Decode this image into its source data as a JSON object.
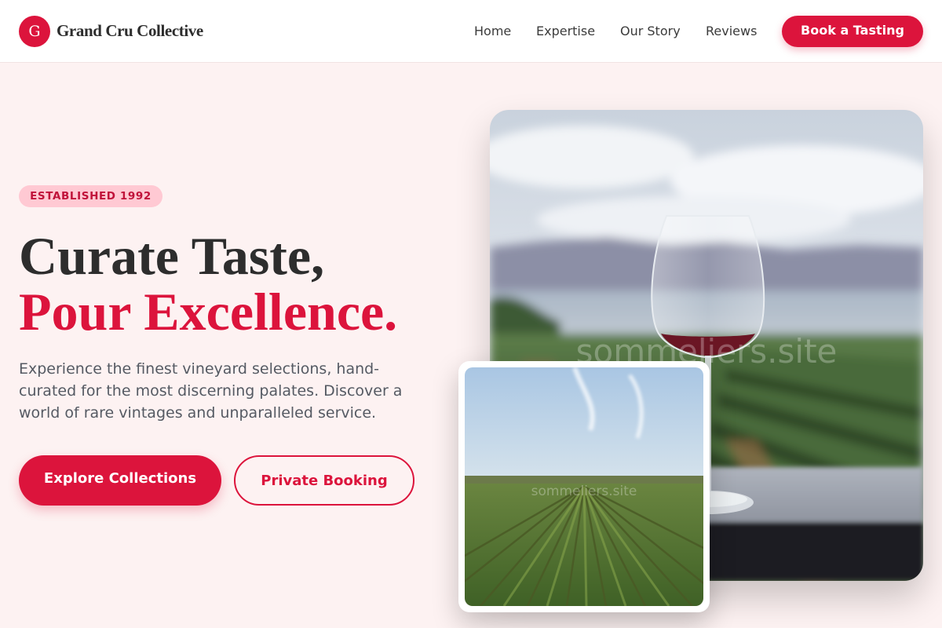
{
  "brand": {
    "initial": "G",
    "name": "Grand Cru Collective"
  },
  "nav": {
    "links": [
      "Home",
      "Expertise",
      "Our Story",
      "Reviews"
    ],
    "cta": "Book a Tasting"
  },
  "hero": {
    "badge": "ESTABLISHED 1992",
    "title_line1": "Curate Taste,",
    "title_line2": "Pour Excellence.",
    "description": "Experience the finest vineyard selections, hand-curated for the most discerning palates. Discover a world of rare vintages and unparalleled service.",
    "primary_button": "Explore Collections",
    "secondary_button": "Private Booking"
  },
  "images": {
    "main_watermark": "sommeliers.site",
    "small_watermark": "sommeliers.site"
  },
  "colors": {
    "accent": "#dc143c",
    "badge_bg": "#ffc9d3",
    "page_bg": "#fdf2f2"
  }
}
